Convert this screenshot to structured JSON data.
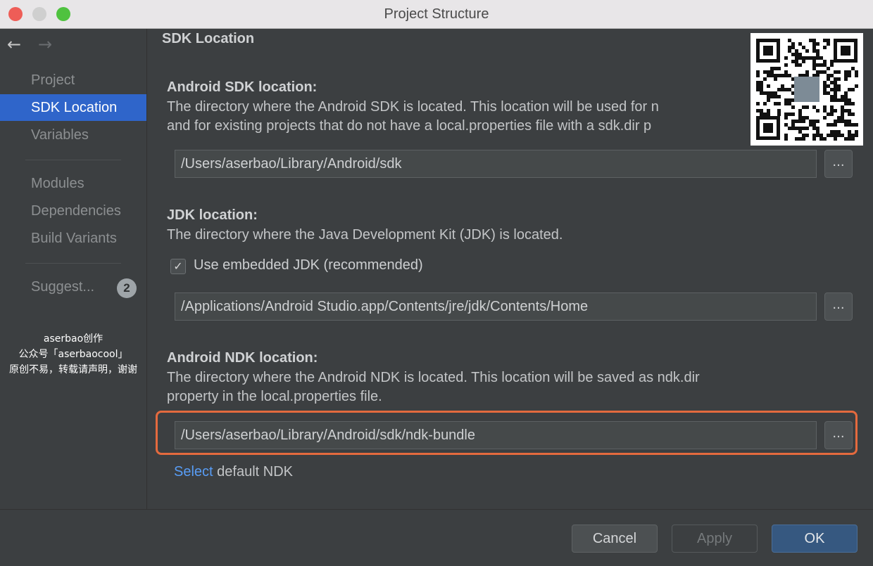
{
  "window": {
    "title": "Project Structure"
  },
  "sidebar": {
    "back_arrow": "←",
    "forward_arrow": "→",
    "items": [
      {
        "label": "Project",
        "selected": false
      },
      {
        "label": "SDK Location",
        "selected": true
      },
      {
        "label": "Variables",
        "selected": false
      },
      {
        "label": "Modules",
        "selected": false
      },
      {
        "label": "Dependencies",
        "selected": false
      },
      {
        "label": "Build Variants",
        "selected": false
      },
      {
        "label": "Suggest...",
        "selected": false
      }
    ],
    "suggestions_badge": "2"
  },
  "watermark": {
    "line1": "aserbao创作",
    "line2": "公众号「aserbaocool」",
    "line3": "原创不易，转载请声明，谢谢"
  },
  "main": {
    "section_title": "SDK Location",
    "android_sdk": {
      "label": "Android SDK location:",
      "desc1": "The directory where the Android SDK is located. This location will be used for n",
      "desc2": "and for existing projects that do not have a local.properties file with a sdk.dir p",
      "path": "/Users/aserbao/Library/Android/sdk",
      "browse": "..."
    },
    "jdk": {
      "label": "JDK location:",
      "desc": "The directory where the Java Development Kit (JDK) is located.",
      "checkbox_label": "Use embedded JDK (recommended)",
      "checkbox_mark": "✓",
      "checked": true,
      "path": "/Applications/Android Studio.app/Contents/jre/jdk/Contents/Home",
      "browse": "..."
    },
    "ndk": {
      "label": "Android NDK location:",
      "desc1": "The directory where the Android NDK is located. This location will be saved as ndk.dir",
      "desc2": "property in the local.properties file.",
      "path": "/Users/aserbao/Library/Android/sdk/ndk-bundle",
      "browse": "...",
      "select_link": "Select",
      "select_rest": " default NDK"
    }
  },
  "footer": {
    "cancel": "Cancel",
    "apply": "Apply",
    "ok": "OK"
  },
  "colors": {
    "selection": "#2f65ca",
    "link": "#589df6",
    "highlight": "#e46a3e",
    "ok_button": "#365880"
  },
  "icons": {
    "qr_code": "qr-code-icon",
    "back": "arrow-left-icon",
    "forward": "arrow-right-icon"
  }
}
